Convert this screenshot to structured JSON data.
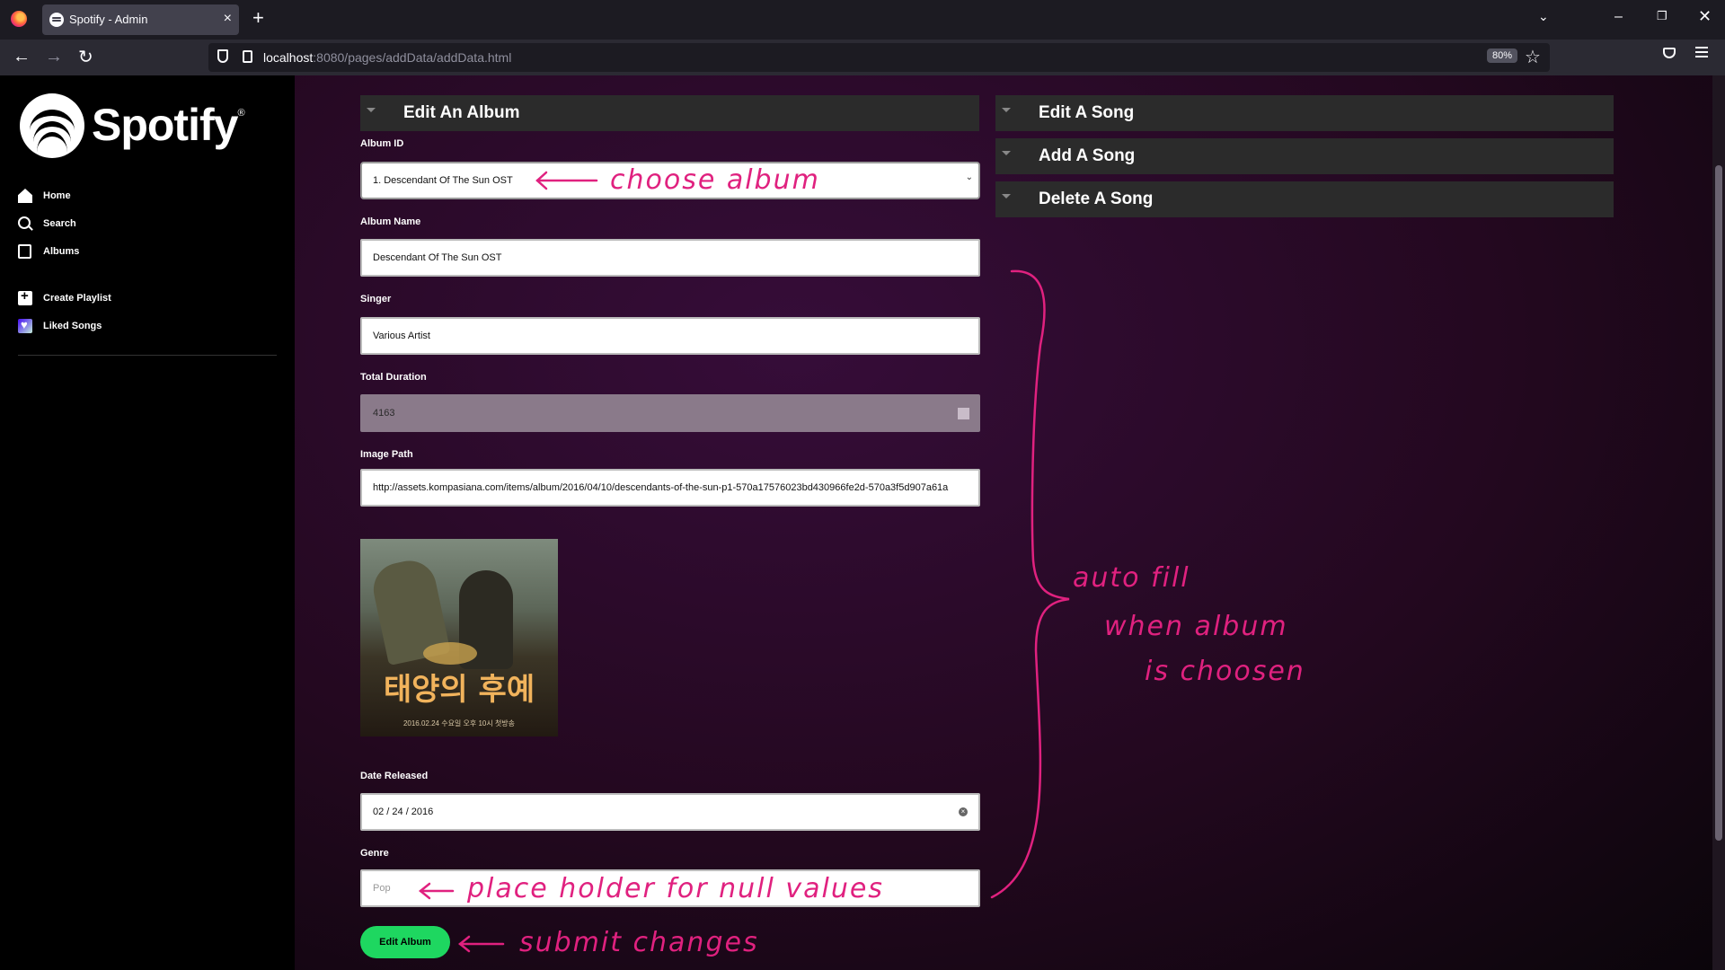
{
  "browser": {
    "tab_title": "Spotify - Admin",
    "url_host": "localhost",
    "url_rest": ":8080/pages/addData/addData.html",
    "zoom": "80%"
  },
  "sidebar": {
    "logo_text": "Spotify",
    "logo_mark": "®",
    "items": [
      {
        "label": "Home",
        "icon": "home-icon"
      },
      {
        "label": "Search",
        "icon": "search-icon"
      },
      {
        "label": "Albums",
        "icon": "albums-icon"
      },
      {
        "label": "Create Playlist",
        "icon": "add-icon"
      },
      {
        "label": "Liked Songs",
        "icon": "heart-icon"
      }
    ]
  },
  "accordions": {
    "edit_album": "Edit An Album",
    "edit_song": "Edit A Song",
    "add_song": "Add A Song",
    "delete_song": "Delete A Song"
  },
  "form": {
    "album_id_label": "Album ID",
    "album_id_value": "1. Descendant Of The Sun OST",
    "album_name_label": "Album Name",
    "album_name_value": "Descendant Of The Sun OST",
    "singer_label": "Singer",
    "singer_value": "Various Artist",
    "duration_label": "Total Duration",
    "duration_value": "4163",
    "image_path_label": "Image Path",
    "image_path_value": "http://assets.kompasiana.com/items/album/2016/04/10/descendants-of-the-sun-p1-570a17576023bd430966fe2d-570a3f5d907a61a",
    "date_label": "Date Released",
    "date_value": "02 / 24 / 2016",
    "genre_label": "Genre",
    "genre_placeholder": "Pop",
    "submit_label": "Edit Album"
  },
  "cover": {
    "title": "태양의 후예",
    "footer": "2016.02.24 수요일 오후 10시 첫방송"
  },
  "annotations": {
    "choose_album": "choose album",
    "auto_fill_1": "auto fill",
    "auto_fill_2": "when album",
    "auto_fill_3": "is choosen",
    "placeholder_note": "place holder for null values",
    "submit_note": "submit changes"
  },
  "colors": {
    "accent_green": "#1ed760",
    "annotation_pink": "#e0217f"
  }
}
